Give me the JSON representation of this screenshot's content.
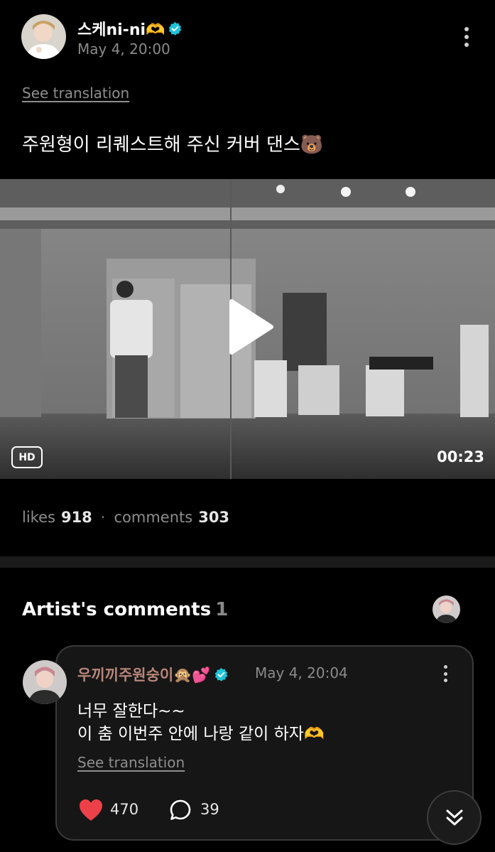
{
  "post": {
    "author_name": "스케ni-ni🫶",
    "date": "May 4, 20:00",
    "see_translation": "See translation",
    "text": "주원형이 리퀘스트해 주신 커버 댄스🐻"
  },
  "video": {
    "hd_label": "HD",
    "duration": "00:23"
  },
  "stats": {
    "likes_label": "likes",
    "likes_value": "918",
    "separator": "·",
    "comments_label": "comments",
    "comments_value": "303"
  },
  "artist_comments": {
    "title": "Artist's comments",
    "count": "1"
  },
  "comment": {
    "author": "우끼끼주원숭이🙊💕",
    "date": "May 4, 20:04",
    "line1": "너무 잘한다~~",
    "line2": "이 춤 이번주 안에 나랑 같이 하자🫶",
    "see_translation": "See translation",
    "likes": "470",
    "replies": "39"
  },
  "colors": {
    "background": "#000000",
    "verified": "#1ec3d8",
    "like_heart": "#ee4048",
    "comment_author": "#b8867a"
  },
  "icons": [
    "verified-badge-icon",
    "more-icon",
    "play-icon",
    "heart-icon",
    "comment-bubble-icon",
    "double-chevron-down-icon"
  ]
}
